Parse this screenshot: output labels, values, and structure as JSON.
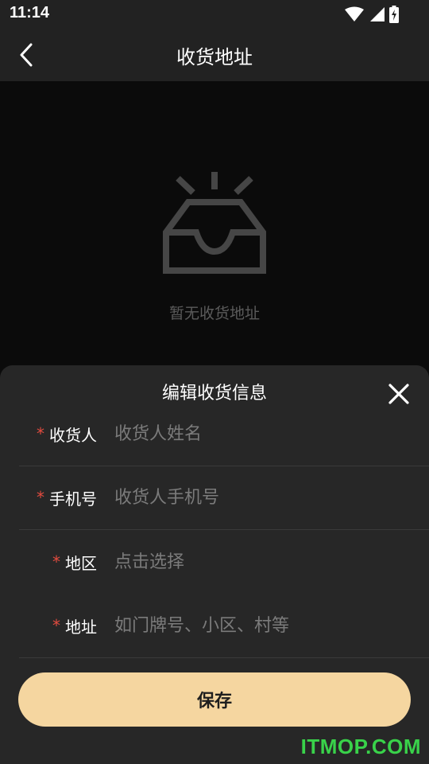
{
  "status_bar": {
    "time": "11:14",
    "icons": [
      "wifi-icon",
      "signal-icon",
      "battery-charging-icon"
    ]
  },
  "header": {
    "title": "收货地址",
    "back_icon": "chevron-left-icon"
  },
  "empty_state": {
    "icon": "empty-inbox-icon",
    "text": "暂无收货地址"
  },
  "sheet": {
    "title": "编辑收货信息",
    "close_icon": "close-icon",
    "fields": [
      {
        "label": "收货人",
        "required_mark": "*",
        "value": "",
        "placeholder": "收货人姓名"
      },
      {
        "label": "手机号",
        "required_mark": "*",
        "value": "",
        "placeholder": "收货人手机号"
      },
      {
        "label": "地区",
        "required_mark": "*",
        "value": "",
        "placeholder": "点击选择"
      },
      {
        "label": "地址",
        "required_mark": "*",
        "value": "",
        "placeholder": "如门牌号、小区、村等"
      }
    ],
    "save_label": "保存"
  },
  "watermark": "ITMOP.COM",
  "colors": {
    "background": "#0b0b0b",
    "bar": "#222222",
    "sheet": "#272727",
    "accent_button": "#f5d6a0",
    "required": "#e24b3f",
    "watermark": "#39d24a"
  }
}
